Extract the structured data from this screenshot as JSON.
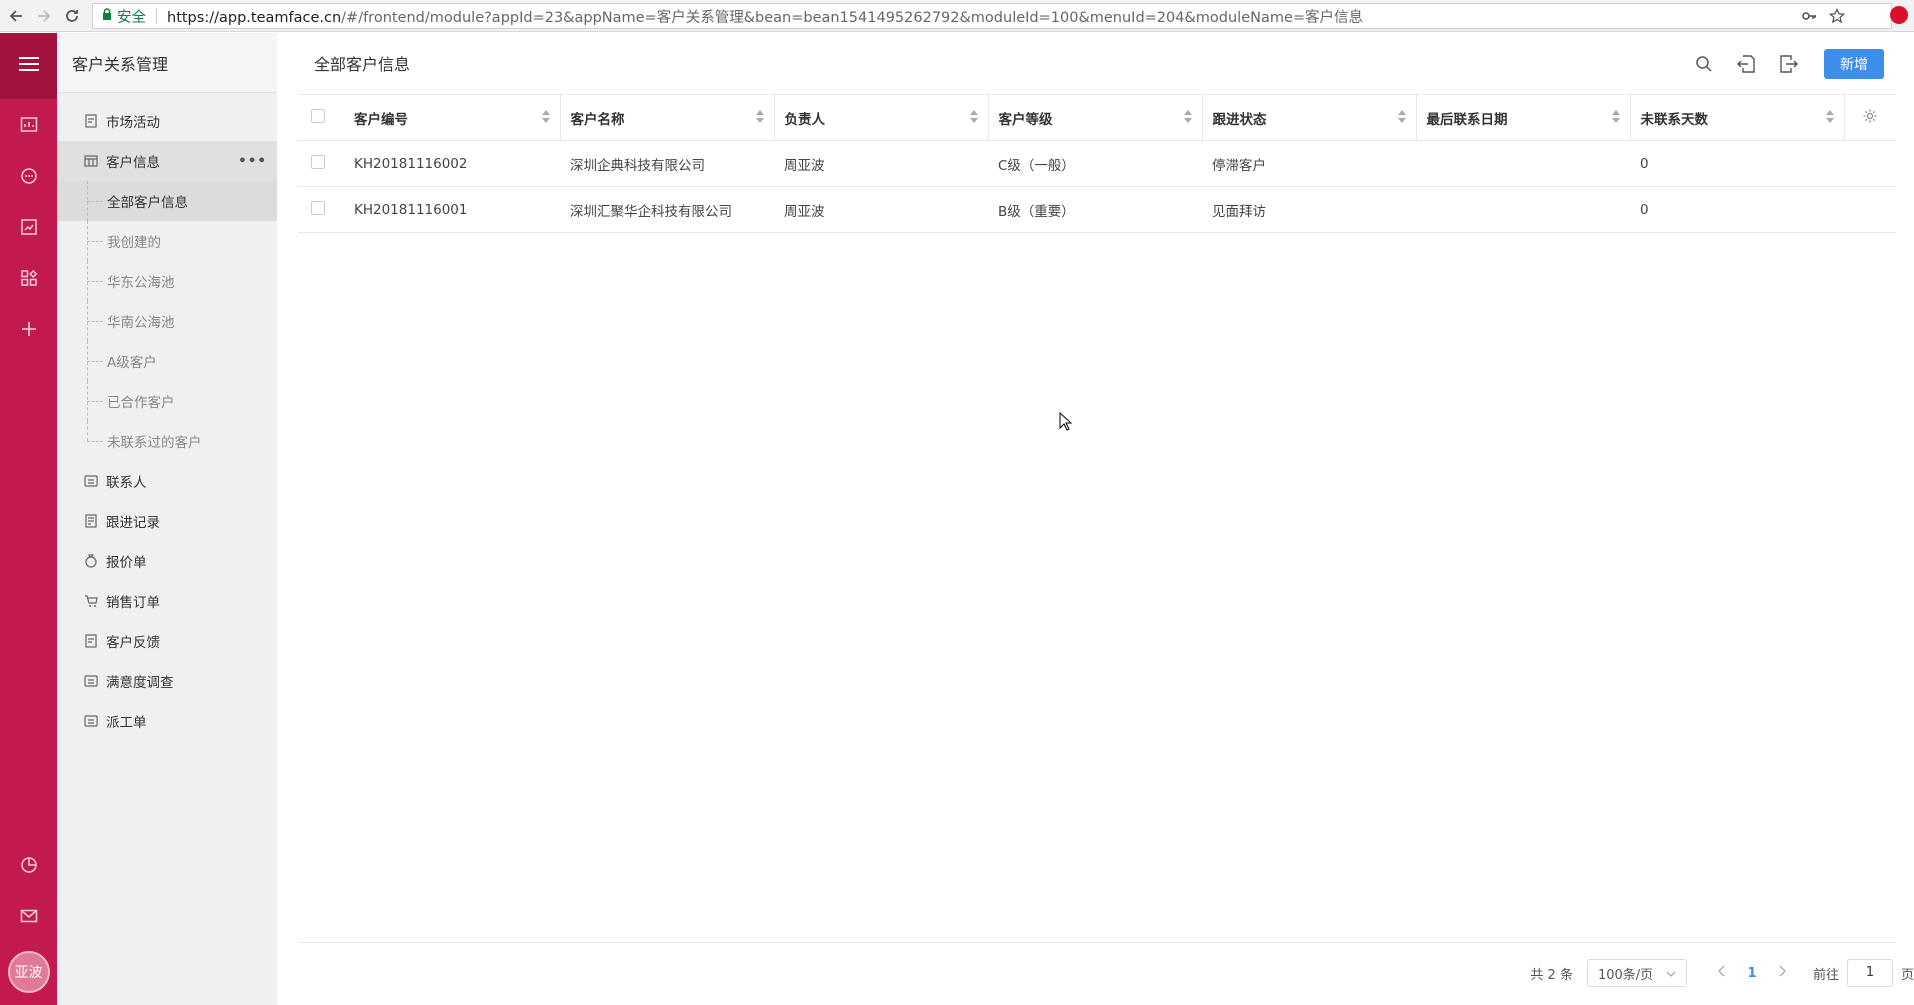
{
  "browser": {
    "secure_label": "安全",
    "url_host": "https://app.teamface.cn",
    "url_path": "/#/frontend/module?appId=23&appName=客户关系管理&bean=bean1541495262792&moduleId=100&menuId=204&moduleName=客户信息"
  },
  "rail": {
    "avatar_text": "亚波"
  },
  "sidenav": {
    "title": "客户关系管理",
    "items": [
      {
        "label": "市场活动"
      },
      {
        "label": "客户信息"
      },
      {
        "label": "联系人"
      },
      {
        "label": "跟进记录"
      },
      {
        "label": "报价单"
      },
      {
        "label": "销售订单"
      },
      {
        "label": "客户反馈"
      },
      {
        "label": "满意度调查"
      },
      {
        "label": "派工单"
      }
    ],
    "sub_items": [
      {
        "label": "全部客户信息"
      },
      {
        "label": "我创建的"
      },
      {
        "label": "华东公海池"
      },
      {
        "label": "华南公海池"
      },
      {
        "label": "A级客户"
      },
      {
        "label": "已合作客户"
      },
      {
        "label": "未联系过的客户"
      }
    ]
  },
  "main": {
    "title": "全部客户信息",
    "add_label": "新增"
  },
  "table": {
    "headers": [
      "客户编号",
      "客户名称",
      "负责人",
      "客户等级",
      "跟进状态",
      "最后联系日期",
      "未联系天数"
    ],
    "rows": [
      [
        "KH20181116002",
        "深圳企典科技有限公司",
        "周亚波",
        "C级（一般）",
        "停滞客户",
        "",
        "0"
      ],
      [
        "KH20181116001",
        "深圳汇聚华企科技有限公司",
        "周亚波",
        "B级（重要）",
        "见面拜访",
        "",
        "0"
      ]
    ]
  },
  "pager": {
    "total": "共 2 条",
    "page_size": "100条/页",
    "current_page": "1",
    "goto_label": "前往",
    "goto_value": "1",
    "page_unit": "页"
  },
  "colors": {
    "rail": "#c21a4e",
    "accent": "#3d8ee8"
  }
}
